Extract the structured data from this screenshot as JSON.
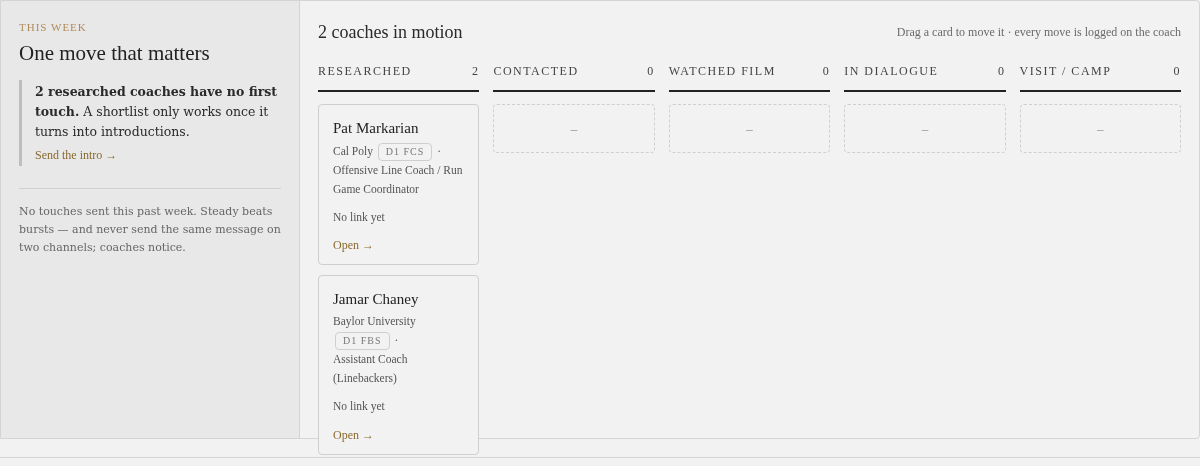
{
  "sidebar": {
    "eyebrow": "THIS WEEK",
    "title": "One move that matters",
    "callout": {
      "text": "**2 researched coaches have no first touch.** A shortlist only works once it turns into introductions.",
      "link": "Send the intro →"
    },
    "note": "No touches sent this past week. Steady beats bursts — and never send the same message on two channels; coaches notice."
  },
  "board": {
    "title": "2 coaches in motion",
    "hint": "Drag a card to move it · every move is logged on the coach",
    "columns": [
      {
        "label": "RESEARCHED",
        "count": "2",
        "cards": [
          {
            "name": "Pat Markarian",
            "school": "Cal Poly",
            "division": "D1 FCS",
            "separator": "·",
            "role": "Offensive Line Coach / Run Game Coordinator",
            "link_status": "No link yet",
            "action": "Open →"
          },
          {
            "name": "Jamar Chaney",
            "school": "Baylor University",
            "division": "D1 FBS",
            "separator": "·",
            "role": "Assistant Coach (Linebackers)",
            "link_status": "No link yet",
            "action": "Open →"
          }
        ]
      },
      {
        "label": "CONTACTED",
        "count": "0",
        "empty_text": "–"
      },
      {
        "label": "WATCHED FILM",
        "count": "0",
        "empty_text": "–"
      },
      {
        "label": "IN DIALOGUE",
        "count": "0",
        "empty_text": "–"
      },
      {
        "label": "VISIT / CAMP",
        "count": "0",
        "empty_text": "–"
      }
    ]
  }
}
